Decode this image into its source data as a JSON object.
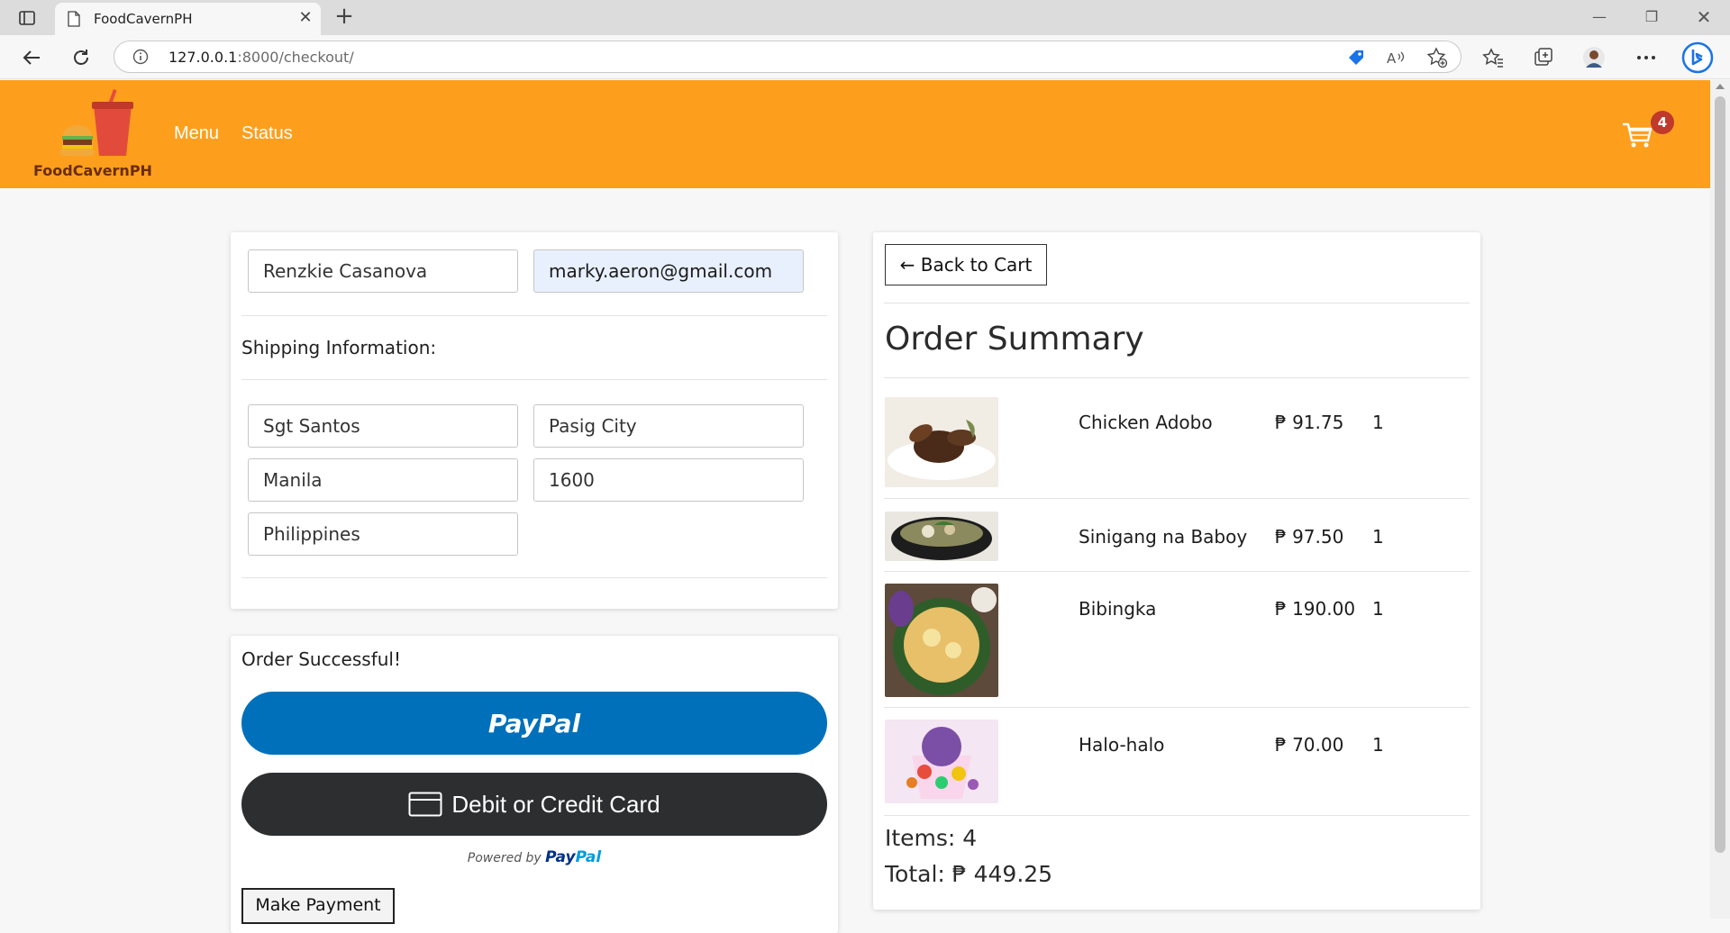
{
  "browser": {
    "tab_title": "FoodCavernPH",
    "url_host": "127.0.0.1",
    "url_path": ":8000/checkout/"
  },
  "site": {
    "brand": "FoodCavernPH",
    "nav": [
      {
        "label": "Menu"
      },
      {
        "label": "Status"
      }
    ],
    "cart_count": "4",
    "colors": {
      "header": "#fd9f1d",
      "badge": "#c0392b"
    }
  },
  "user_form": {
    "name": "Renzkie Casanova",
    "email": "marky.aeron@gmail.com"
  },
  "shipping": {
    "heading": "Shipping Information:",
    "address": "Sgt Santos",
    "city": "Pasig City",
    "state": "Manila",
    "zipcode": "1600",
    "country": "Philippines"
  },
  "payment": {
    "status": "Order Successful!",
    "paypal_label": "PayPal",
    "card_label": "Debit or Credit Card",
    "powered_by": "Powered by",
    "powered_brand_a": "Pay",
    "powered_brand_b": "Pal",
    "make_payment": "Make Payment"
  },
  "summary": {
    "back_label": "← Back to Cart",
    "title": "Order Summary",
    "items": [
      {
        "name": "Chicken Adobo",
        "price": "₱ 91.75",
        "qty": "1"
      },
      {
        "name": "Sinigang na Baboy",
        "price": "₱ 97.50",
        "qty": "1"
      },
      {
        "name": "Bibingka",
        "price": "₱ 190.00",
        "qty": "1"
      },
      {
        "name": "Halo-halo",
        "price": "₱ 70.00",
        "qty": "1"
      }
    ],
    "items_count": "Items: 4",
    "total": "Total: ₱ 449.25"
  }
}
